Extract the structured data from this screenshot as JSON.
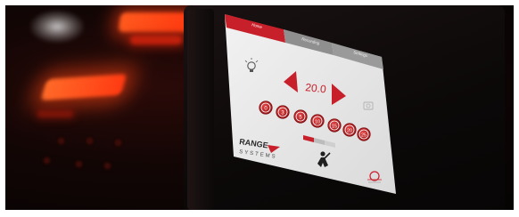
{
  "screen": {
    "tabs": [
      {
        "label": "Home",
        "active": true
      },
      {
        "label": "Recording",
        "active": false
      },
      {
        "label": "Settings",
        "active": false
      }
    ],
    "value_display": "20.0",
    "preset_buttons": [
      "0",
      "3",
      "5",
      "10",
      "15",
      "20",
      "25"
    ],
    "brand": {
      "name_top": "RANGE",
      "name_bottom": "SYSTEMS"
    },
    "mode_toggle": [
      "",
      "",
      ""
    ],
    "colors": {
      "accent": "#c8202a",
      "screen_bg": "#ececec",
      "tab_inactive": "#8a8a8a"
    },
    "icons": {
      "light": "lightbulb-icon",
      "camera": "camera-icon",
      "person": "person-icon",
      "power": "power-logo-icon"
    }
  }
}
